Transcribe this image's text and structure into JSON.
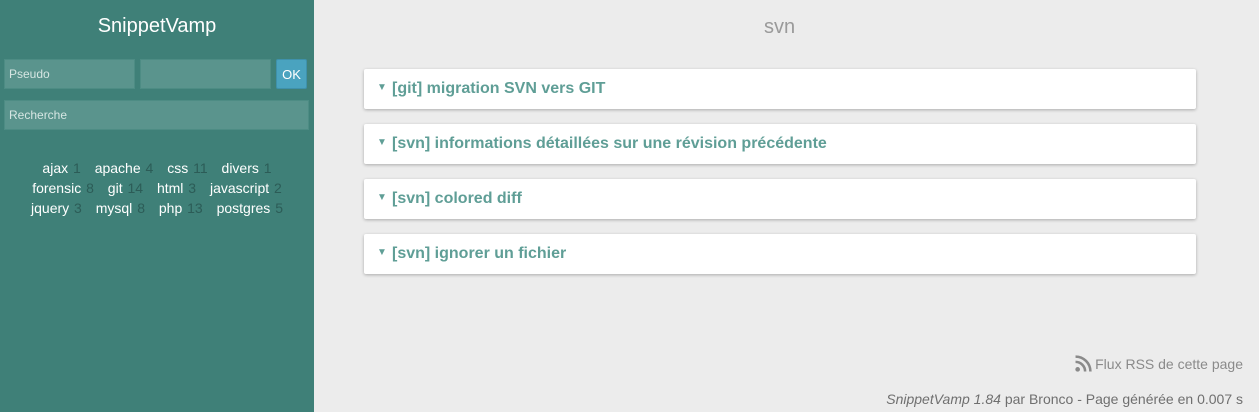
{
  "sidebar": {
    "brand": "SnippetVamp",
    "login": {
      "pseudo_placeholder": "Pseudo",
      "password_placeholder": "",
      "ok_label": "OK"
    },
    "search_placeholder": "Recherche",
    "tags": [
      {
        "name": "ajax",
        "count": "1"
      },
      {
        "name": "apache",
        "count": "4"
      },
      {
        "name": "css",
        "count": "11"
      },
      {
        "name": "divers",
        "count": "1"
      },
      {
        "name": "forensic",
        "count": "8"
      },
      {
        "name": "git",
        "count": "14"
      },
      {
        "name": "html",
        "count": "3"
      },
      {
        "name": "javascript",
        "count": "2"
      },
      {
        "name": "jquery",
        "count": "3"
      },
      {
        "name": "mysql",
        "count": "8"
      },
      {
        "name": "php",
        "count": "13"
      },
      {
        "name": "postgres",
        "count": "5"
      }
    ]
  },
  "main": {
    "title": "svn",
    "snippets": [
      {
        "title": "[git] migration SVN vers GIT"
      },
      {
        "title": "[svn] informations détaillées sur une révision précédente"
      },
      {
        "title": "[svn] colored diff"
      },
      {
        "title": "[svn] ignorer un fichier"
      }
    ],
    "arrow_glyph": "▼",
    "rss_label": "Flux RSS de cette page",
    "footer": {
      "app": "SnippetVamp 1.84",
      "rest": " par Bronco - Page générée en 0.007 s"
    }
  },
  "colors": {
    "sidebar_bg": "#3f8078",
    "accent_text": "#5f9e96",
    "ok_button": "#4aa3bf"
  }
}
